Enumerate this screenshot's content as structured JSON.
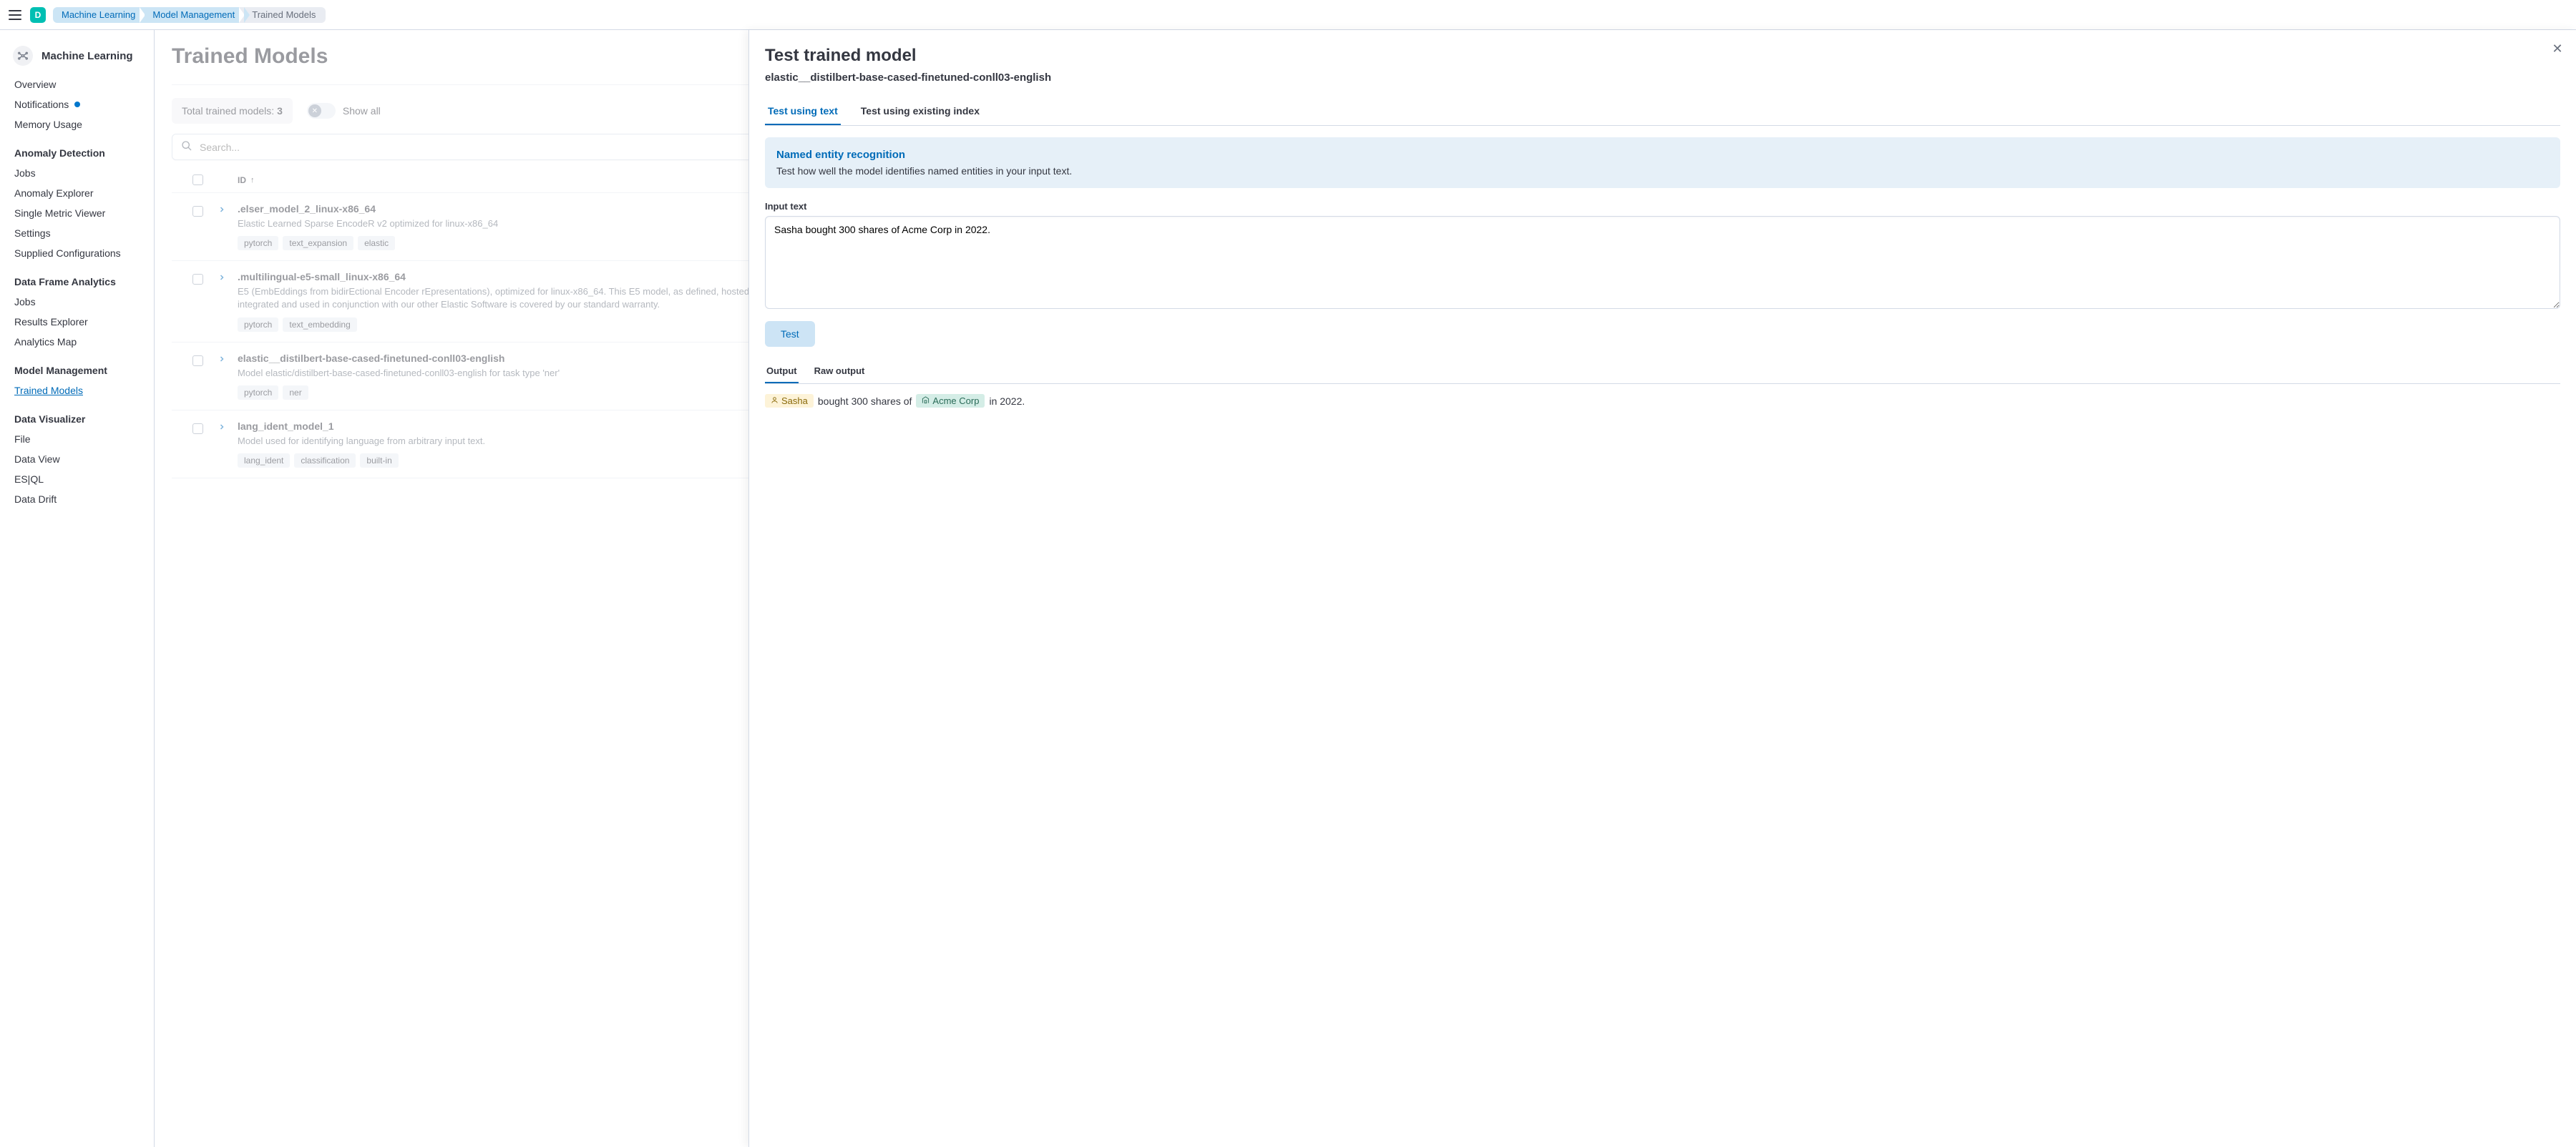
{
  "topbar": {
    "avatar_letter": "D",
    "breadcrumbs": [
      "Machine Learning",
      "Model Management",
      "Trained Models"
    ]
  },
  "sidebar": {
    "app_title": "Machine Learning",
    "top_links": [
      "Overview",
      "Notifications",
      "Memory Usage"
    ],
    "groups": [
      {
        "title": "Anomaly Detection",
        "items": [
          "Jobs",
          "Anomaly Explorer",
          "Single Metric Viewer",
          "Settings",
          "Supplied Configurations"
        ]
      },
      {
        "title": "Data Frame Analytics",
        "items": [
          "Jobs",
          "Results Explorer",
          "Analytics Map"
        ]
      },
      {
        "title": "Model Management",
        "items": [
          "Trained Models"
        ]
      },
      {
        "title": "Data Visualizer",
        "items": [
          "File",
          "Data View",
          "ES|QL",
          "Data Drift"
        ]
      }
    ],
    "active_item": "Trained Models"
  },
  "page": {
    "title": "Trained Models",
    "total_label": "Total trained models: ",
    "total_count": "3",
    "show_all_label": "Show all",
    "search_placeholder": "Search...",
    "id_header": "ID"
  },
  "rows": [
    {
      "id": ".elser_model_2_linux-x86_64",
      "desc": "Elastic Learned Sparse EncodeR v2 optimized for linux-x86_64",
      "badges": [
        "pytorch",
        "text_expansion",
        "elastic"
      ]
    },
    {
      "id": ".multilingual-e5-small_linux-x86_64",
      "desc": "E5 (EmbEddings from bidirEctional Encoder rEpresentations), optimized for linux-x86_64. This E5 model, as defined, hosted, integrated and used in conjunction with our other Elastic Software is covered by our standard warranty.",
      "badges": [
        "pytorch",
        "text_embedding"
      ]
    },
    {
      "id": "elastic__distilbert-base-cased-finetuned-conll03-english",
      "desc": "Model elastic/distilbert-base-cased-finetuned-conll03-english for task type 'ner'",
      "badges": [
        "pytorch",
        "ner"
      ]
    },
    {
      "id": "lang_ident_model_1",
      "desc": "Model used for identifying language from arbitrary input text.",
      "badges": [
        "lang_ident",
        "classification",
        "built-in"
      ]
    }
  ],
  "flyout": {
    "title": "Test trained model",
    "model_id": "elastic__distilbert-base-cased-finetuned-conll03-english",
    "tabs": [
      "Test using text",
      "Test using existing index"
    ],
    "info_title": "Named entity recognition",
    "info_desc": "Test how well the model identifies named entities in your input text.",
    "input_label": "Input text",
    "input_value": "Sasha bought 300 shares of Acme Corp in 2022.",
    "test_button": "Test",
    "subtabs": [
      "Output",
      "Raw output"
    ],
    "output": {
      "ent1": "Sasha",
      "mid1": " bought 300 shares of ",
      "ent2": "Acme Corp",
      "tail": " in 2022."
    }
  }
}
